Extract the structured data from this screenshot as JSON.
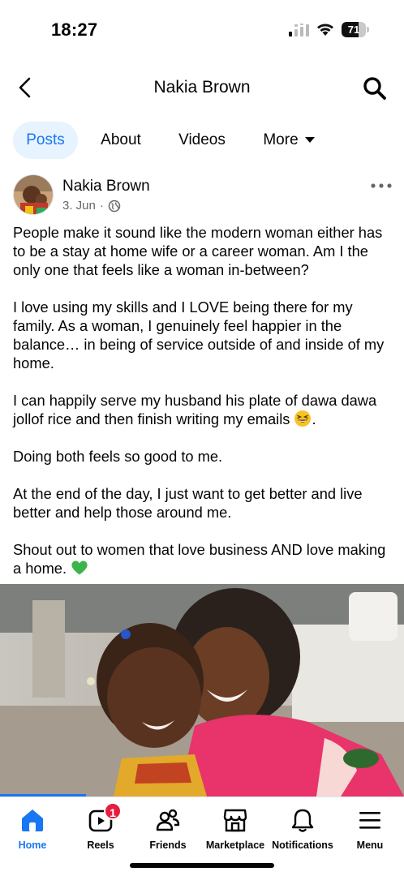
{
  "status_bar": {
    "time": "18:27",
    "battery": "71",
    "battery_level": 0.71
  },
  "header": {
    "title": "Nakia Brown"
  },
  "tabs": [
    {
      "label": "Posts",
      "active": true
    },
    {
      "label": "About",
      "active": false
    },
    {
      "label": "Videos",
      "active": false
    },
    {
      "label": "More",
      "active": false
    }
  ],
  "post": {
    "author": "Nakia Brown",
    "date": "3. Jun",
    "separator": "·",
    "audience_icon": "globe-icon",
    "paragraphs": [
      "People make it sound like the modern woman either has to be a stay at home wife or a career woman. Am I the only one that feels like a woman in-between?",
      "I love using my skills and I LOVE being there for my family. As a woman, I genuinely feel happier in the balance… in being of service outside of and inside of my home.",
      "I can happily serve my husband his plate of dawa dawa jollof rice and then finish writing my emails",
      "Doing both feels so good to me.",
      "At the end of the day, I just want to get better and live better and help those around me.",
      "Shout out to women that love business AND love making a home."
    ],
    "emoji_1": "grinning-squinting-face",
    "emoji_1_suffix": ".",
    "emoji_2": "green-heart"
  },
  "bottom_nav": [
    {
      "label": "Home",
      "icon": "home-icon",
      "active": true
    },
    {
      "label": "Reels",
      "icon": "reels-icon",
      "badge": "1"
    },
    {
      "label": "Friends",
      "icon": "friends-icon"
    },
    {
      "label": "Marketplace",
      "icon": "marketplace-icon"
    },
    {
      "label": "Notifications",
      "icon": "bell-icon"
    },
    {
      "label": "Menu",
      "icon": "menu-icon"
    }
  ],
  "colors": {
    "accent": "#1877f2",
    "tab_active_bg": "#e7f3ff",
    "badge": "#e41e3f",
    "secondary_text": "#65676b"
  }
}
